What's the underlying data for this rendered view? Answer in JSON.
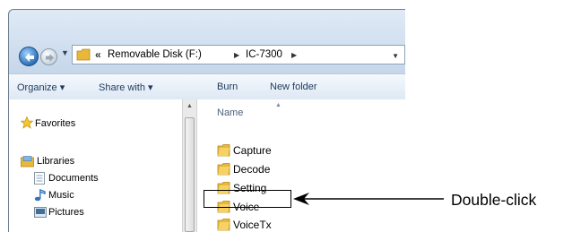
{
  "address_bar": {
    "overflow": "«",
    "segments": [
      "Removable Disk (F:)",
      "IC-7300"
    ]
  },
  "toolbar": {
    "organize": "Organize ▾",
    "share_with": "Share with ▾",
    "burn": "Burn",
    "new_folder": "New folder"
  },
  "nav_pane": {
    "favorites": "Favorites",
    "libraries": "Libraries",
    "documents": "Documents",
    "music": "Music",
    "pictures": "Pictures"
  },
  "content": {
    "column_header": "Name",
    "items": [
      "Capture",
      "Decode",
      "Setting",
      "Voice",
      "VoiceTx"
    ],
    "selected_item": "Voice"
  },
  "annotation": {
    "label": "Double-click"
  },
  "colors": {
    "folder": "#e8b83a",
    "toolbar_text": "#1e395b"
  }
}
